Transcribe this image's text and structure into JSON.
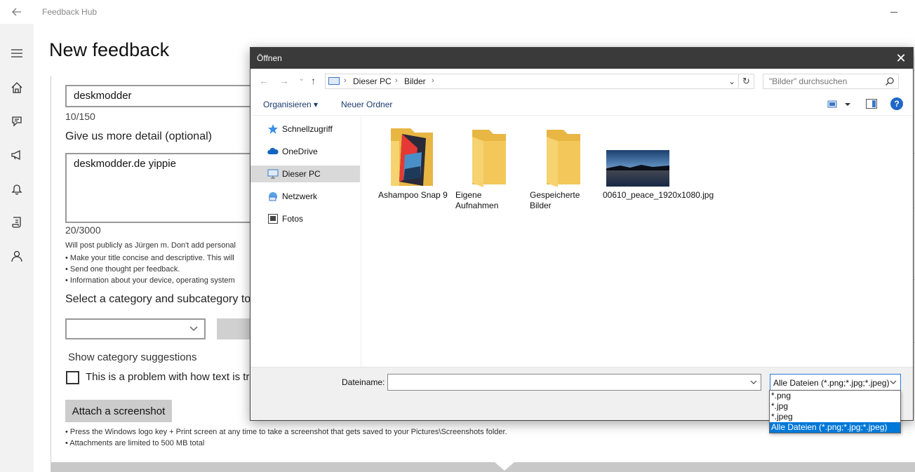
{
  "app": {
    "title": "Feedback Hub",
    "page_title": "New feedback"
  },
  "form": {
    "title_value": "deskmodder",
    "title_count": "10/150",
    "detail_label": "Give us more detail (optional)",
    "detail_value": "deskmodder.de yippie",
    "detail_count": "20/3000",
    "public_notice": "Will post publicly as Jürgen m. Don't add personal",
    "tip_1": "• Make your title concise and descriptive. This will",
    "tip_2": "• Send one thought per feedback.",
    "tip_3": "• Information about your device, operating system",
    "category_label": "Select a category and subcategory to",
    "category_value": "",
    "show_suggestions": "Show category suggestions",
    "checkbox_label": "This is a problem with how text is tr",
    "attach_label": "Attach a screenshot",
    "attach_tip_1": "• Press the Windows logo key + Print screen at any time to take a screenshot that gets saved to your Pictures\\Screenshots folder.",
    "attach_tip_2": "• Attachments are limited to 500 MB total"
  },
  "dialog": {
    "title": "Öffnen",
    "close_glyph": "✕",
    "nav": {
      "back_glyph": "←",
      "forward_glyph": "→",
      "recent_glyph": "⌄",
      "up_glyph": "↑"
    },
    "address": {
      "crumbs": [
        "Dieser PC",
        "Bilder"
      ],
      "separator": "›",
      "dropdown_glyph": "⌄",
      "refresh_glyph": "↻"
    },
    "search_placeholder": "\"Bilder\" durchsuchen",
    "commands": {
      "organize": "Organisieren ▾",
      "new_folder": "Neuer Ordner",
      "help_glyph": "?"
    },
    "nav_pane": [
      {
        "label": "Schnellzugriff",
        "icon": "star-icon"
      },
      {
        "label": "OneDrive",
        "icon": "cloud-icon"
      },
      {
        "label": "Dieser PC",
        "icon": "computer-icon",
        "selected": true
      },
      {
        "label": "Netzwerk",
        "icon": "network-icon"
      },
      {
        "label": "Fotos",
        "icon": "photos-icon"
      }
    ],
    "files": [
      {
        "label": "Ashampoo Snap 9",
        "type": "folder-special"
      },
      {
        "label": "Eigene Aufnahmen",
        "type": "folder"
      },
      {
        "label": "Gespeicherte Bilder",
        "type": "folder"
      },
      {
        "label": "00610_peace_1920x1080.jpg",
        "type": "image"
      }
    ],
    "filename_label": "Dateiname:",
    "filename_value": "",
    "filetype_value": "Alle Dateien (*.png;*.jpg;*.jpeg)",
    "filetype_options": [
      "*.png",
      "*.jpg",
      "*.jpeg",
      "Alle Dateien (*.png;*.jpg;*.jpeg)"
    ],
    "filetype_selected_index": 3
  },
  "colors": {
    "dialog_titlebar": "#3a3a3a",
    "accent": "#0078d7",
    "folder": "#f4c75a"
  }
}
